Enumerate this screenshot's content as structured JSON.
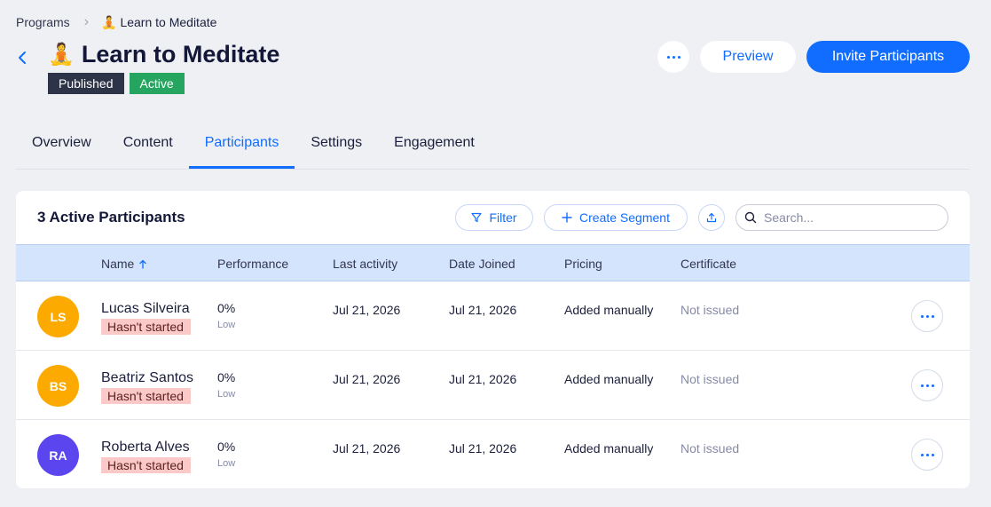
{
  "breadcrumb": {
    "root": "Programs",
    "current": "Learn to Meditate",
    "current_emoji": "🧘"
  },
  "header": {
    "title": "Learn to Meditate",
    "title_emoji": "🧘",
    "badges": {
      "published": "Published",
      "active": "Active"
    },
    "preview_label": "Preview",
    "invite_label": "Invite Participants"
  },
  "tabs": [
    {
      "label": "Overview"
    },
    {
      "label": "Content"
    },
    {
      "label": "Participants",
      "selected": true
    },
    {
      "label": "Settings"
    },
    {
      "label": "Engagement"
    }
  ],
  "participants": {
    "title": "3 Active Participants",
    "filter_label": "Filter",
    "segment_label": "Create Segment",
    "search_placeholder": "Search...",
    "columns": {
      "name": "Name",
      "performance": "Performance",
      "last_activity": "Last activity",
      "date_joined": "Date Joined",
      "pricing": "Pricing",
      "certificate": "Certificate"
    },
    "rows": [
      {
        "initials": "LS",
        "avatar_color": "#fcaa00",
        "name": "Lucas Silveira",
        "status": "Hasn't started",
        "performance": "0%",
        "performance_level": "Low",
        "last_activity": "Jul 21, 2026",
        "date_joined": "Jul 21, 2026",
        "pricing": "Added manually",
        "certificate": "Not issued"
      },
      {
        "initials": "BS",
        "avatar_color": "#fcaa00",
        "name": "Beatriz Santos",
        "status": "Hasn't started",
        "performance": "0%",
        "performance_level": "Low",
        "last_activity": "Jul 21, 2026",
        "date_joined": "Jul 21, 2026",
        "pricing": "Added manually",
        "certificate": "Not issued"
      },
      {
        "initials": "RA",
        "avatar_color": "#5b45ee",
        "name": "Roberta Alves",
        "status": "Hasn't started",
        "performance": "0%",
        "performance_level": "Low",
        "last_activity": "Jul 21, 2026",
        "date_joined": "Jul 21, 2026",
        "pricing": "Added manually",
        "certificate": "Not issued"
      }
    ]
  },
  "colors": {
    "accent": "#116dff",
    "published": "#2e3448",
    "active": "#25a55f",
    "status_badge": "#fcc9c9",
    "table_header": "#d4e4fc"
  }
}
